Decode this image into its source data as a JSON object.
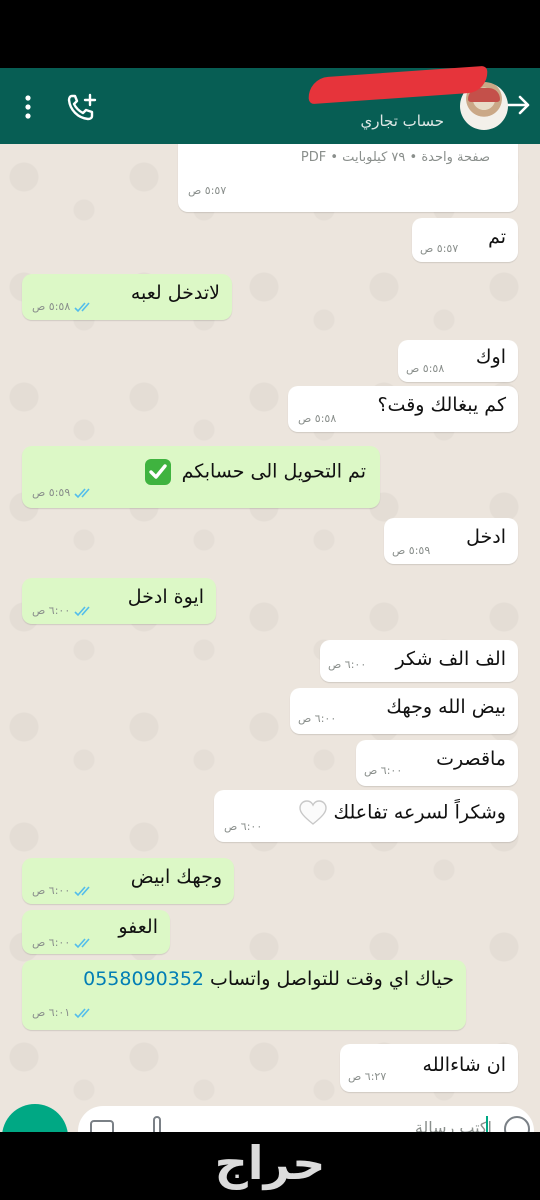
{
  "header": {
    "subtitle": "حساب تجاري",
    "colors": {
      "bar": "#075e54"
    }
  },
  "messages": [
    {
      "kind": "in",
      "text": "صفحة واحدة • ٧٩ كيلوبايت • PDF",
      "time": "٥:٥٧ ص"
    },
    {
      "kind": "in",
      "text": "تم",
      "time": "٥:٥٧ ص"
    },
    {
      "kind": "out",
      "text": "لاتدخل لعبه",
      "time": "٥:٥٨ ص"
    },
    {
      "kind": "in",
      "text": "اوك",
      "time": "٥:٥٨ ص"
    },
    {
      "kind": "in",
      "text": "كم يبغالك وقت؟",
      "time": "٥:٥٨ ص"
    },
    {
      "kind": "out",
      "text": "تم التحويل الى حسابكم",
      "time": "٥:٥٩ ص",
      "icon": "check-mark-button-emoji"
    },
    {
      "kind": "in",
      "text": "ادخل",
      "time": "٥:٥٩ ص"
    },
    {
      "kind": "out",
      "text": "ايوة ادخل",
      "time": "٦:٠٠ ص"
    },
    {
      "kind": "in",
      "text": "الف الف شكر",
      "time": "٦:٠٠ ص"
    },
    {
      "kind": "in",
      "text": "بيض الله وجهك",
      "time": "٦:٠٠ ص"
    },
    {
      "kind": "in",
      "text": "ماقصرت",
      "time": "٦:٠٠ ص"
    },
    {
      "kind": "in",
      "text": "وشكراً لسرعه تفاعلك",
      "time": "٦:٠٠ ص",
      "icon": "white-heart-emoji"
    },
    {
      "kind": "out",
      "text": "وجهك ابيض",
      "time": "٦:٠٠ ص"
    },
    {
      "kind": "out",
      "text": "العفو",
      "time": "٦:٠٠ ص"
    },
    {
      "kind": "out",
      "text": "حياك اي وقت للتواصل واتساب",
      "phone": "0558090352",
      "time": "٦:٠١ ص"
    },
    {
      "kind": "in",
      "text": "ان شاءالله",
      "time": "٦:٢٧ ص"
    }
  ],
  "composer": {
    "placeholder": "اكتب رسالة"
  },
  "footer": {
    "brand": "حراج"
  },
  "colors": {
    "incoming": "#ffffff",
    "outgoing": "#dcf8c6",
    "read_ticks": "#53bdeb",
    "link": "#027eb5"
  }
}
